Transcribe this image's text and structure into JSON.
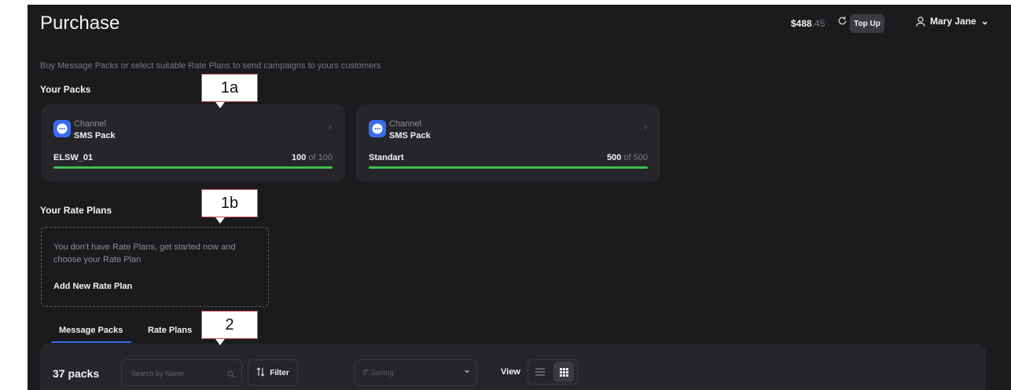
{
  "header": {
    "title": "Purchase",
    "balance_main": "$488",
    "balance_cents": ".45",
    "refresh_icon": "refresh-icon",
    "topup_label": "Top Up",
    "user_name": "Mary Jane",
    "user_chevron": "⌄"
  },
  "subtitle": "Buy Message Packs or select suitable Rate Plans to send campaigns to yours customers",
  "packs": {
    "heading": "Your Packs",
    "items": [
      {
        "channel_label": "Channel",
        "type": "SMS Pack",
        "name": "ELSW_01",
        "used": "100",
        "of_label": "of 100",
        "fill_fraction": 1.0
      },
      {
        "channel_label": "Channel",
        "type": "SMS Pack",
        "name": "Standart",
        "used": "500",
        "of_label": "of 500",
        "fill_fraction": 1.0
      }
    ],
    "chevron": "›"
  },
  "rate_plans": {
    "heading": "Your Rate Plans",
    "empty_text": "You don't have Rate Plans, get started now and choose your Rate Plan",
    "add_label": "Add New Rate Plan"
  },
  "tabs": [
    {
      "label": "Message Packs",
      "active": true
    },
    {
      "label": "Rate Plans",
      "active": false
    }
  ],
  "toolbar": {
    "count_label": "37 packs",
    "search_placeholder": "Search by Name",
    "filter_label": "Filter",
    "sorting_placeholder": "Sorting",
    "view_label": "View"
  },
  "callouts": {
    "c1a": "1a",
    "c1b": "1b",
    "c2": "2"
  },
  "colors": {
    "accent": "#3b6cf0",
    "progress": "#3fbf4f",
    "callout_border": "#c0504d"
  }
}
